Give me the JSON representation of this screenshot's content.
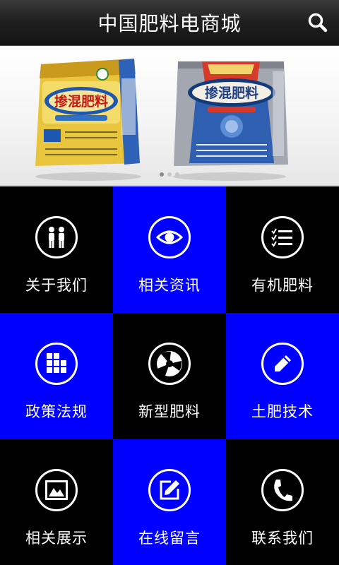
{
  "header": {
    "title": "中国肥料电商城",
    "search_icon": "search-icon"
  },
  "banner": {
    "slide_count": 3,
    "active_slide": 1,
    "products": [
      {
        "name": "掺混肥料",
        "bag_color": "#e8c23a",
        "accent": "#2f6fc4"
      },
      {
        "name": "掺混肥料",
        "bag_color": "#9aa0a8",
        "accent": "#d63a2a"
      }
    ]
  },
  "menu": [
    {
      "label": "关于我们",
      "icon": "people-icon",
      "color": "#000000"
    },
    {
      "label": "相关资讯",
      "icon": "eye-icon",
      "color": "#0000ff"
    },
    {
      "label": "有机肥料",
      "icon": "checklist-icon",
      "color": "#000000"
    },
    {
      "label": "政策法规",
      "icon": "grid-icon",
      "color": "#0000ff"
    },
    {
      "label": "新型肥料",
      "icon": "aperture-icon",
      "color": "#000000"
    },
    {
      "label": "土肥技术",
      "icon": "pencil-icon",
      "color": "#0000ff"
    },
    {
      "label": "相关展示",
      "icon": "image-icon",
      "color": "#000000"
    },
    {
      "label": "在线留言",
      "icon": "edit-icon",
      "color": "#0000ff"
    },
    {
      "label": "联系我们",
      "icon": "phone-icon",
      "color": "#000000"
    }
  ]
}
